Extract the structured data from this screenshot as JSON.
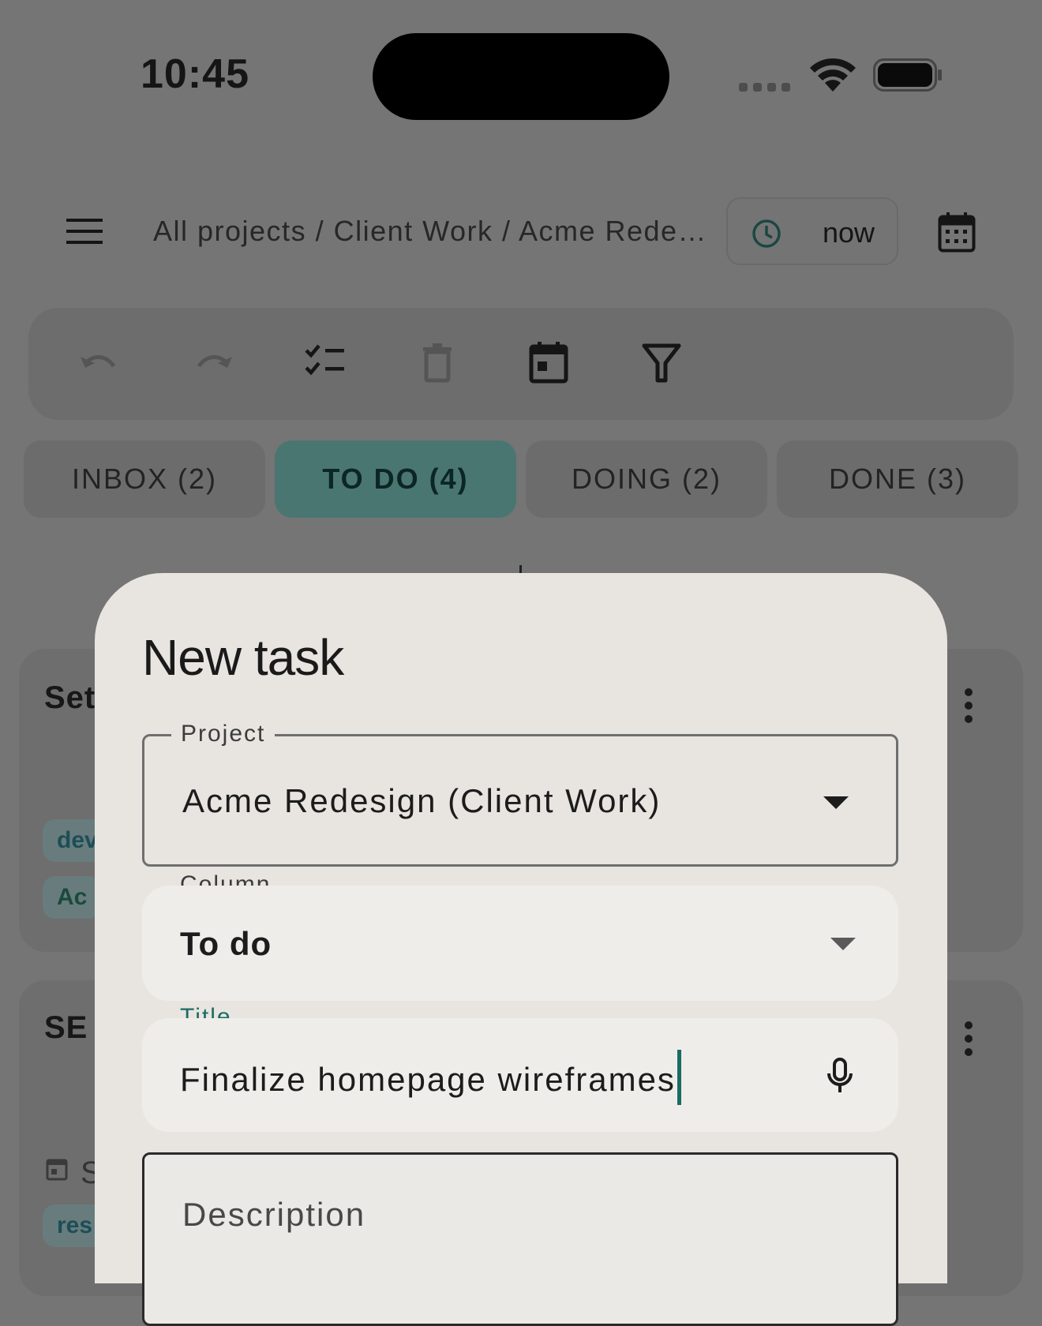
{
  "status_bar": {
    "time": "10:45"
  },
  "header": {
    "breadcrumb": "All projects / Client Work / Acme Rede…",
    "time_chip": "now"
  },
  "toolbar": {
    "icons": [
      "undo-icon",
      "redo-icon",
      "checklist-icon",
      "delete-icon",
      "calendar-today-icon",
      "filter-icon"
    ]
  },
  "tabs": [
    {
      "label": "INBOX (2)",
      "active": false
    },
    {
      "label": "TO DO (4)",
      "active": true
    },
    {
      "label": "DOING (2)",
      "active": false
    },
    {
      "label": "DONE (3)",
      "active": false
    }
  ],
  "background_cards": [
    {
      "title_fragment": "Set",
      "chips": [
        "dev",
        "Ac"
      ]
    },
    {
      "title_fragment": "SE",
      "date_fragment": "S",
      "chips": [
        "res"
      ]
    }
  ],
  "dialog": {
    "title": "New task",
    "project": {
      "label": "Project",
      "value": "Acme Redesign (Client Work)"
    },
    "column": {
      "label": "Column",
      "value": "To do"
    },
    "title_field": {
      "label": "Title",
      "value": "Finalize homepage wireframes"
    },
    "description": {
      "placeholder": "Description"
    }
  },
  "colors": {
    "accent": "#1b6b63",
    "active_tab": "#4a7672",
    "scrim_background": "#757575",
    "dialog_surface": "#e8e5e0"
  }
}
